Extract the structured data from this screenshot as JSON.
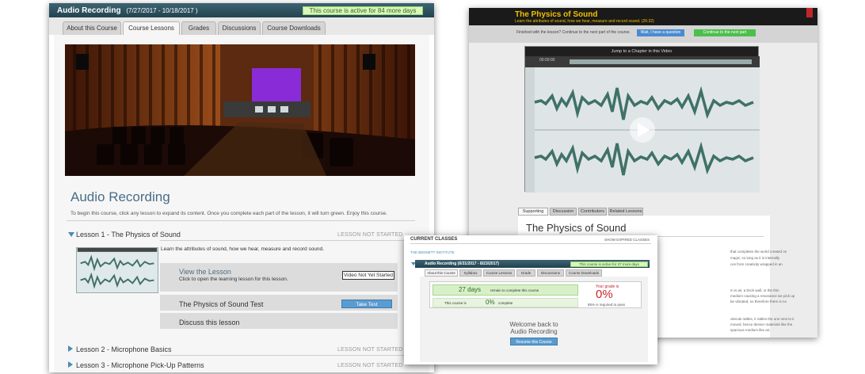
{
  "left_window": {
    "course_title": "Audio Recording",
    "dates": "(7/27/2017 - 10/18/2017 )",
    "active_badge": "This course is active for 84 more days",
    "tabs": [
      "About this Course",
      "Course Lessons",
      "Grades",
      "Discussions",
      "Course Downloads"
    ],
    "active_tab": "Course Lessons",
    "heading": "Audio Recording",
    "intro": "To begin this course, click any lesson to expand its content. Once you complete each part of the lesson, it will turn green. Enjoy this course.",
    "lessons": [
      {
        "title": "Lesson 1 - The Physics of Sound",
        "status": "LESSON NOT STARTED"
      },
      {
        "title": "Lesson 2 - Microphone Basics",
        "status": "LESSON NOT STARTED"
      },
      {
        "title": "Lesson 3 - Microphone Pick-Up Patterns",
        "status": "LESSON NOT STARTED"
      }
    ],
    "lesson1": {
      "description": "Learn the attributes of sound, how we hear, measure and record sound.",
      "view_title": "View the Lesson",
      "view_desc": "Click to open the learning lesson for this lesson.",
      "video_status": "Video Not Yet Started",
      "test_title": "The Physics of Sound Test",
      "test_button": "Take Test",
      "discuss": "Discuss this lesson"
    }
  },
  "right_window": {
    "title": "The Physics of Sound",
    "subtitle": "Learn the attributes of sound, how we hear, measure and record sound. (26:32)",
    "finished_prompt": "Finished with the lesson? Continue to the next part of the course.",
    "question_button": "Wait, I have a question",
    "continue_button": "Continue to the next part",
    "jump_label": "Jump to a Chapter in this Video",
    "timecode": "00:00:00",
    "tabs": [
      "Supporting Info",
      "Discussion",
      "Contributors",
      "Related Lessons"
    ],
    "active_tab": "Supporting Info",
    "section_heading": "The Physics of Sound",
    "text_fragments": [
      "that completes the world created on",
      "magic; so long as it is internally",
      "ces from creativity wrapped in an",
      "m is air, a brick wall, or the thin",
      "medium causing a resonance we pick up",
      "be vibrated, so therefore there is no",
      "olecule rattles, it rattles the one next to it",
      "moved, hence denser materials like the",
      "spacious medium like air."
    ],
    "colors": {
      "title": "#f0c000",
      "question": "#4a8bd0",
      "continue": "#4cbf4c"
    }
  },
  "bottom_window": {
    "current_classes": "CURRENT CLASSES",
    "show_expired": "SHOW EXPIRED CLASSES",
    "institute": "THE BENNETT INSTITUTE",
    "course_title": "Audio Recording (6/31/2017 - 8/23/2017)",
    "active_badge": "This course is active for 27 more days",
    "tabs": [
      "About this Course",
      "Syllabus",
      "Course Lessons",
      "Grade",
      "Discussions",
      "Course Downloads"
    ],
    "active_tab": "About this Course",
    "days": "27 days",
    "days_text": "remain to complete this course",
    "complete_prefix": "This course is",
    "complete_pct": "0%",
    "complete_suffix": "complete",
    "grade_label": "Your grade is",
    "grade_value": "0%",
    "pass_text": "85% is required to pass",
    "welcome_line1": "Welcome back to",
    "welcome_line2": "Audio Recording",
    "resume_button": "Resume this Course"
  }
}
